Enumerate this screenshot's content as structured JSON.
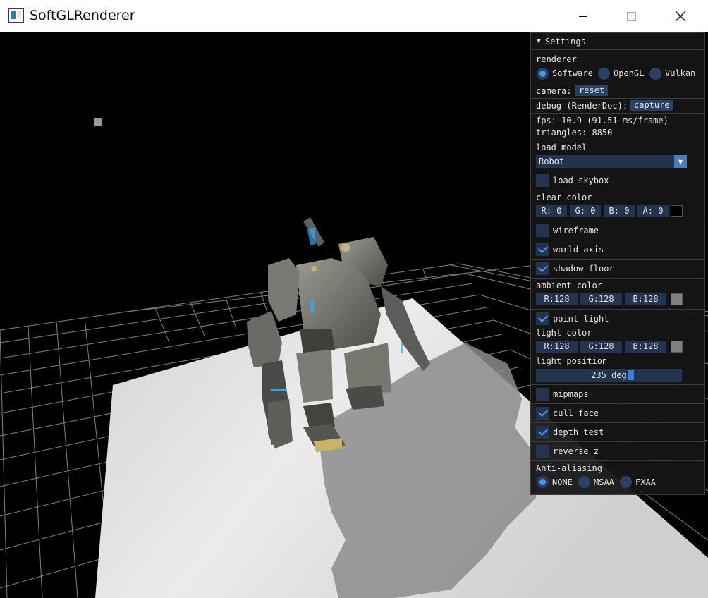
{
  "window": {
    "title": "SoftGLRenderer",
    "close_glyph": "✕"
  },
  "settings": {
    "header": "Settings",
    "renderer_label": "renderer",
    "renderer_options": [
      "Software",
      "OpenGL",
      "Vulkan"
    ],
    "renderer_selected": "Software",
    "camera_label": "camera:",
    "camera_reset": "reset",
    "debug_label": "debug (RenderDoc):",
    "debug_capture": "capture",
    "fps_text": "fps: 10.9 (91.51 ms/frame)",
    "triangles_text": "triangles: 8850",
    "load_model_label": "load model",
    "model_selected": "Robot",
    "load_skybox": "load skybox",
    "clear_color_label": "clear color",
    "clear_color": {
      "r": "R:  0",
      "g": "G:  0",
      "b": "B:  0",
      "a": "A:  0",
      "swatch": "#000000"
    },
    "wireframe": "wireframe",
    "world_axis": "world axis",
    "shadow_floor": "shadow floor",
    "ambient_color_label": "ambient color",
    "ambient_color": {
      "r": "R:128",
      "g": "G:128",
      "b": "B:128",
      "swatch": "#808080"
    },
    "point_light": "point light",
    "light_color_label": "light color",
    "light_color": {
      "r": "R:128",
      "g": "G:128",
      "b": "B:128",
      "swatch": "#808080"
    },
    "light_position_label": "light position",
    "light_position_value": "235 deg",
    "light_position_fraction": 0.65,
    "mipmaps": "mipmaps",
    "cull_face": "cull face",
    "depth_test": "depth test",
    "reverse_z": "reverse z",
    "aa_label": "Anti-aliasing",
    "aa_options": [
      "NONE",
      "MSAA",
      "FXAA"
    ],
    "aa_selected": "NONE",
    "checks": {
      "load_skybox": false,
      "wireframe": false,
      "world_axis": true,
      "shadow_floor": true,
      "point_light": true,
      "mipmaps": false,
      "cull_face": true,
      "depth_test": true,
      "reverse_z": false
    }
  },
  "colors": {
    "accent": "#4296fa",
    "frame_bg": "#22344e",
    "button_bg": "#294163"
  }
}
